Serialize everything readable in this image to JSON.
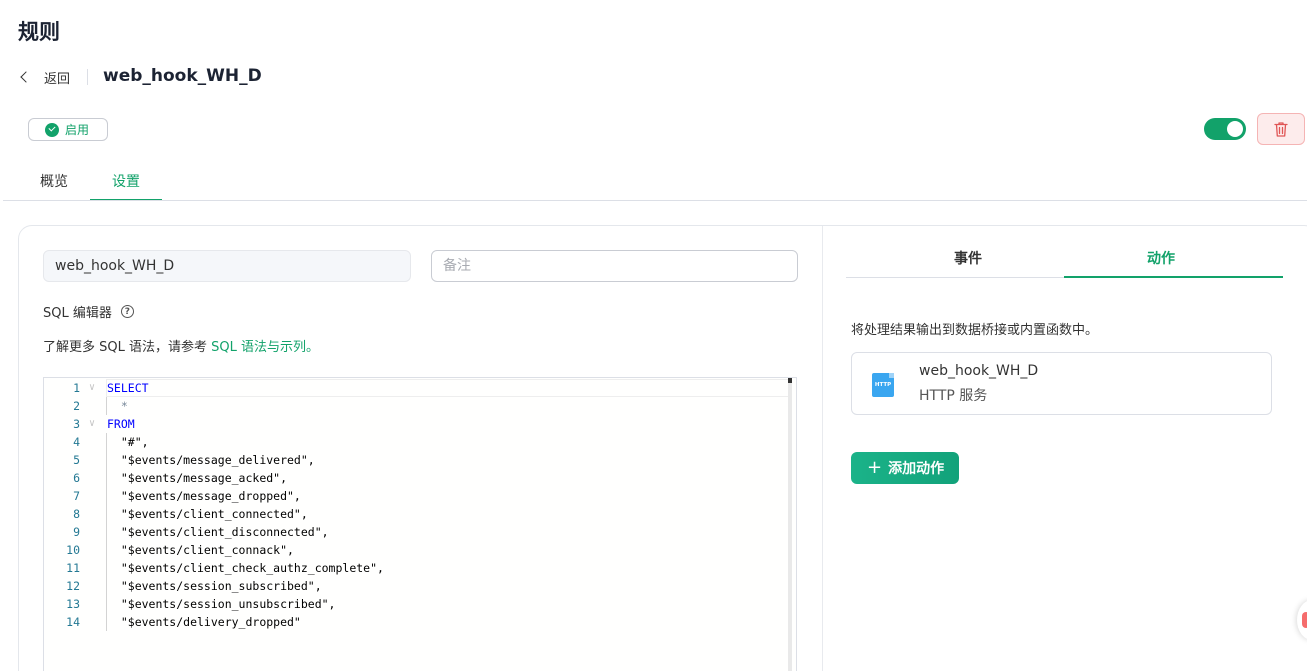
{
  "page": {
    "title": "规则"
  },
  "header": {
    "back_label": "返回",
    "rule_name": "web_hook_WH_D"
  },
  "status": {
    "label": "启用",
    "color": "#12a26a"
  },
  "controls": {
    "toggle_state": "on",
    "delete_icon": "trash-icon"
  },
  "tabs": [
    {
      "label": "概览",
      "active": false
    },
    {
      "label": "设置",
      "active": true
    }
  ],
  "form": {
    "name_value": "web_hook_WH_D",
    "note_placeholder": "备注",
    "sql_label": "SQL 编辑器",
    "hint_prefix": "了解更多 SQL 语法，请参考 ",
    "hint_link": "SQL 语法与示列。"
  },
  "editor": {
    "lines": [
      {
        "num": "1",
        "text": "SELECT",
        "type": "kw",
        "fold": true
      },
      {
        "num": "2",
        "text": "  *",
        "type": "op",
        "fold": false
      },
      {
        "num": "3",
        "text": "FROM",
        "type": "kw",
        "fold": true
      },
      {
        "num": "4",
        "text": "  \"#\",",
        "type": "str",
        "fold": false
      },
      {
        "num": "5",
        "text": "  \"$events/message_delivered\",",
        "type": "str",
        "fold": false
      },
      {
        "num": "6",
        "text": "  \"$events/message_acked\",",
        "type": "str",
        "fold": false
      },
      {
        "num": "7",
        "text": "  \"$events/message_dropped\",",
        "type": "str",
        "fold": false
      },
      {
        "num": "8",
        "text": "  \"$events/client_connected\",",
        "type": "str",
        "fold": false
      },
      {
        "num": "9",
        "text": "  \"$events/client_disconnected\",",
        "type": "str",
        "fold": false
      },
      {
        "num": "10",
        "text": "  \"$events/client_connack\",",
        "type": "str",
        "fold": false
      },
      {
        "num": "11",
        "text": "  \"$events/client_check_authz_complete\",",
        "type": "str",
        "fold": false
      },
      {
        "num": "12",
        "text": "  \"$events/session_subscribed\",",
        "type": "str",
        "fold": false
      },
      {
        "num": "13",
        "text": "  \"$events/session_unsubscribed\",",
        "type": "str",
        "fold": false
      },
      {
        "num": "14",
        "text": "  \"$events/delivery_dropped\"",
        "type": "str",
        "fold": false
      }
    ]
  },
  "right_panel": {
    "tabs": [
      {
        "label": "事件",
        "active": false
      },
      {
        "label": "动作",
        "active": true
      }
    ],
    "description": "将处理结果输出到数据桥接或内置函数中。",
    "action": {
      "icon_text": "HTTP",
      "name": "web_hook_WH_D",
      "type": "HTTP 服务"
    },
    "add_button": "添加动作"
  },
  "colors": {
    "accent": "#12a26a",
    "danger": "#f56c6c"
  }
}
